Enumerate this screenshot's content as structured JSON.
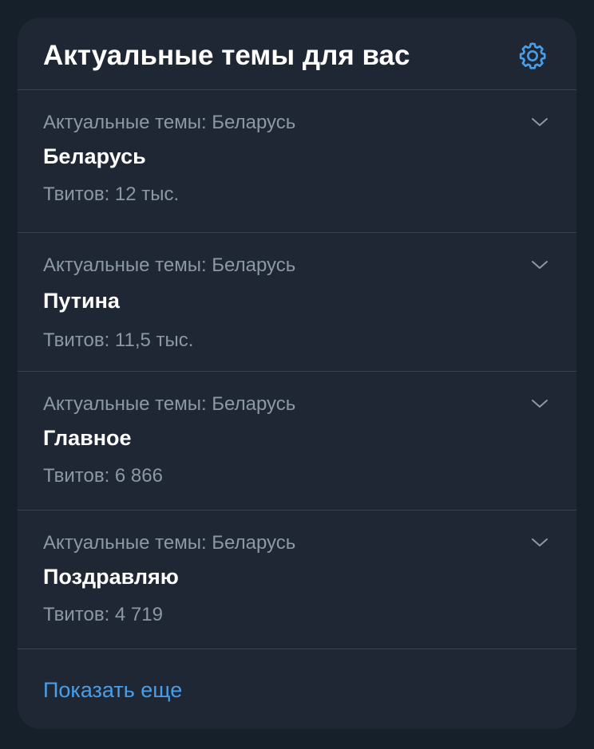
{
  "header": {
    "title": "Актуальные темы для вас",
    "settings_icon": "gear-icon"
  },
  "trends": [
    {
      "meta": "Актуальные темы: Беларусь",
      "name": "Беларусь",
      "count": "Твитов: 12 тыс."
    },
    {
      "meta": "Актуальные темы: Беларусь",
      "name": "Путина",
      "count": "Твитов: 11,5 тыс."
    },
    {
      "meta": "Актуальные темы: Беларусь",
      "name": "Главное",
      "count": "Твитов: 6 866"
    },
    {
      "meta": "Актуальные темы: Беларусь",
      "name": "Поздравляю",
      "count": "Твитов: 4 719"
    }
  ],
  "footer": {
    "show_more_label": "Показать еще"
  },
  "colors": {
    "page_background": "#15202b",
    "card_background": "#1e2733",
    "divider": "#3a444f",
    "primary_text": "#ffffff",
    "secondary_text": "#8b98a5",
    "accent": "#4a9ee8"
  }
}
